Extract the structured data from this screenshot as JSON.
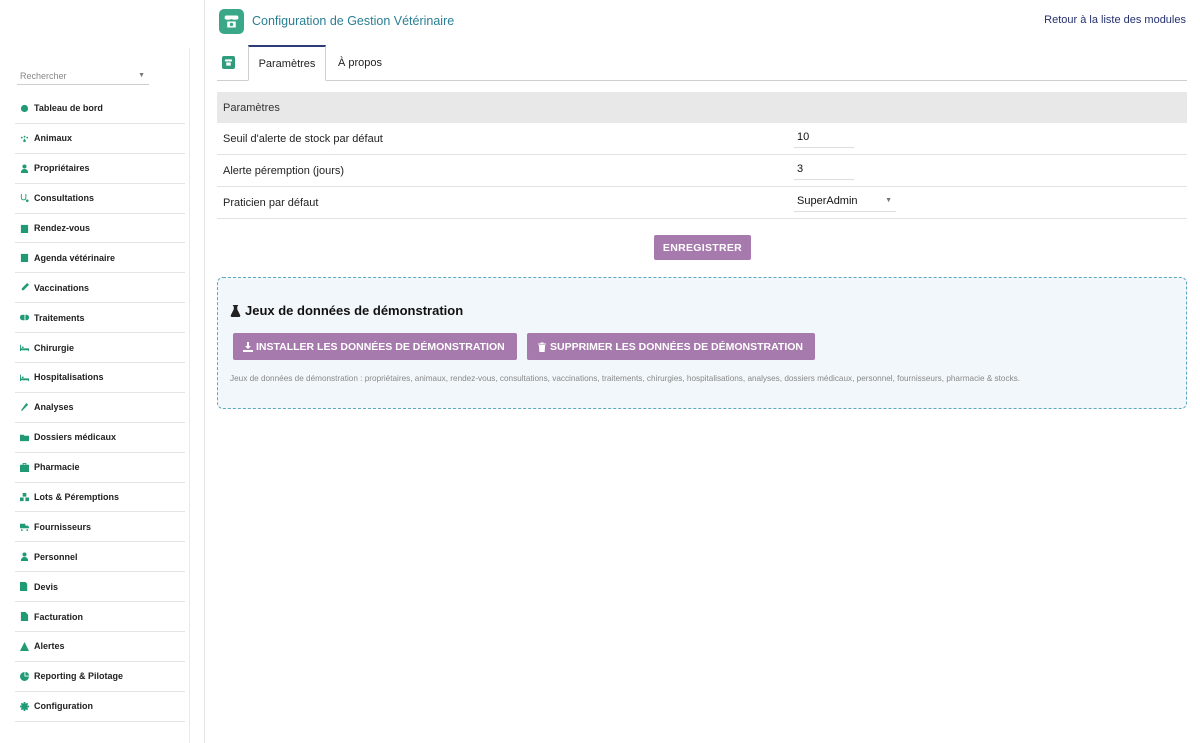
{
  "app": {
    "title": "Configuration de Gestion Vétérinaire",
    "back_link": "Retour à la liste des modules"
  },
  "sidebar": {
    "search_placeholder": "Rechercher",
    "items": [
      {
        "label": "Tableau de bord",
        "icon": "dashboard-icon"
      },
      {
        "label": "Animaux",
        "icon": "paw-icon"
      },
      {
        "label": "Propriétaires",
        "icon": "user-icon"
      },
      {
        "label": "Consultations",
        "icon": "stethoscope-icon"
      },
      {
        "label": "Rendez-vous",
        "icon": "calendar-check-icon"
      },
      {
        "label": "Agenda vétérinaire",
        "icon": "calendar-icon"
      },
      {
        "label": "Vaccinations",
        "icon": "syringe-icon"
      },
      {
        "label": "Traitements",
        "icon": "pills-icon"
      },
      {
        "label": "Chirurgie",
        "icon": "bed-icon"
      },
      {
        "label": "Hospitalisations",
        "icon": "hospital-bed-icon"
      },
      {
        "label": "Analyses",
        "icon": "microscope-icon"
      },
      {
        "label": "Dossiers médicaux",
        "icon": "folder-icon"
      },
      {
        "label": "Pharmacie",
        "icon": "medkit-icon"
      },
      {
        "label": "Lots & Péremptions",
        "icon": "boxes-icon"
      },
      {
        "label": "Fournisseurs",
        "icon": "truck-icon"
      },
      {
        "label": "Personnel",
        "icon": "user-md-icon"
      },
      {
        "label": "Devis",
        "icon": "file-signature-icon"
      },
      {
        "label": "Facturation",
        "icon": "file-invoice-icon"
      },
      {
        "label": "Alertes",
        "icon": "warning-icon"
      },
      {
        "label": "Reporting & Pilotage",
        "icon": "chart-pie-icon"
      },
      {
        "label": "Configuration",
        "icon": "gear-icon"
      }
    ]
  },
  "tabs": [
    {
      "label": "Paramètres",
      "active": true
    },
    {
      "label": "À propos",
      "active": false
    }
  ],
  "params": {
    "header": "Paramètres",
    "rows": [
      {
        "label": "Seuil d'alerte de stock par défaut",
        "value": "10"
      },
      {
        "label": "Alerte péremption (jours)",
        "value": "3"
      },
      {
        "label": "Praticien par défaut",
        "value": "SuperAdmin"
      }
    ],
    "save_label": "ENREGISTRER"
  },
  "demo": {
    "title": "Jeux de données de démonstration",
    "install_label": "INSTALLER LES DONNÉES DE DÉMONSTRATION",
    "delete_label": "SUPPRIMER LES DONNÉES DE DÉMONSTRATION",
    "note": "Jeux de données de démonstration : propriétaires, animaux, rendez-vous, consultations, vaccinations, traitements, chirurgies, hospitalisations, analyses, dossiers médicaux, personnel, fournisseurs, pharmacie & stocks."
  },
  "colors": {
    "accent_green": "#1f9a74",
    "button_purple": "#a77aad",
    "title_teal": "#2a7f94",
    "link_navy": "#24306b"
  }
}
